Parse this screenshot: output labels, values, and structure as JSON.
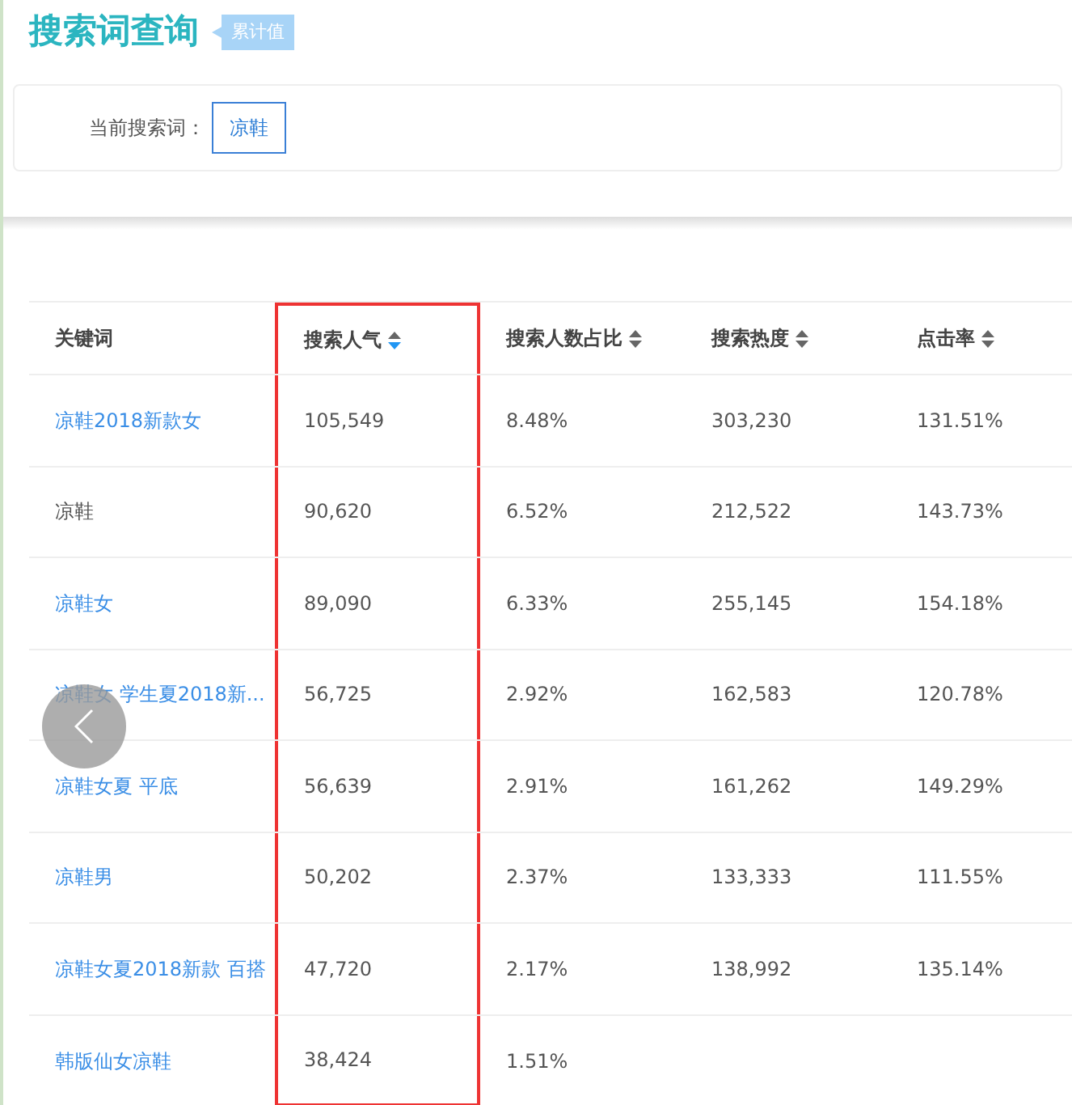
{
  "title": "搜索词查询",
  "badge": "累计值",
  "search": {
    "label": "当前搜索词：",
    "value": "凉鞋"
  },
  "columns": [
    {
      "label": "关键词",
      "highlight": false
    },
    {
      "label": "搜索人气",
      "sorted": true,
      "highlight": true
    },
    {
      "label": "搜索人数占比",
      "sorted": false,
      "highlight": false
    },
    {
      "label": "搜索热度",
      "sorted": false,
      "highlight": false
    },
    {
      "label": "点击率",
      "sorted": false,
      "highlight": false
    }
  ],
  "rows": [
    {
      "keyword": "凉鞋2018新款女",
      "link": true,
      "values": [
        "105,549",
        "8.48%",
        "303,230",
        "131.51%"
      ]
    },
    {
      "keyword": "凉鞋",
      "link": false,
      "values": [
        "90,620",
        "6.52%",
        "212,522",
        "143.73%"
      ]
    },
    {
      "keyword": "凉鞋女",
      "link": true,
      "values": [
        "89,090",
        "6.33%",
        "255,145",
        "154.18%"
      ]
    },
    {
      "keyword": "凉鞋女 学生夏2018新...",
      "link": true,
      "values": [
        "56,725",
        "2.92%",
        "162,583",
        "120.78%"
      ]
    },
    {
      "keyword": "凉鞋女夏 平底",
      "link": true,
      "values": [
        "56,639",
        "2.91%",
        "161,262",
        "149.29%"
      ]
    },
    {
      "keyword": "凉鞋男",
      "link": true,
      "values": [
        "50,202",
        "2.37%",
        "133,333",
        "111.55%"
      ]
    },
    {
      "keyword": "凉鞋女夏2018新款 百搭",
      "link": true,
      "values": [
        "47,720",
        "2.17%",
        "138,992",
        "135.14%"
      ]
    },
    {
      "keyword": "韩版仙女凉鞋",
      "link": true,
      "values": [
        "38,424",
        "1.51%"
      ]
    }
  ]
}
